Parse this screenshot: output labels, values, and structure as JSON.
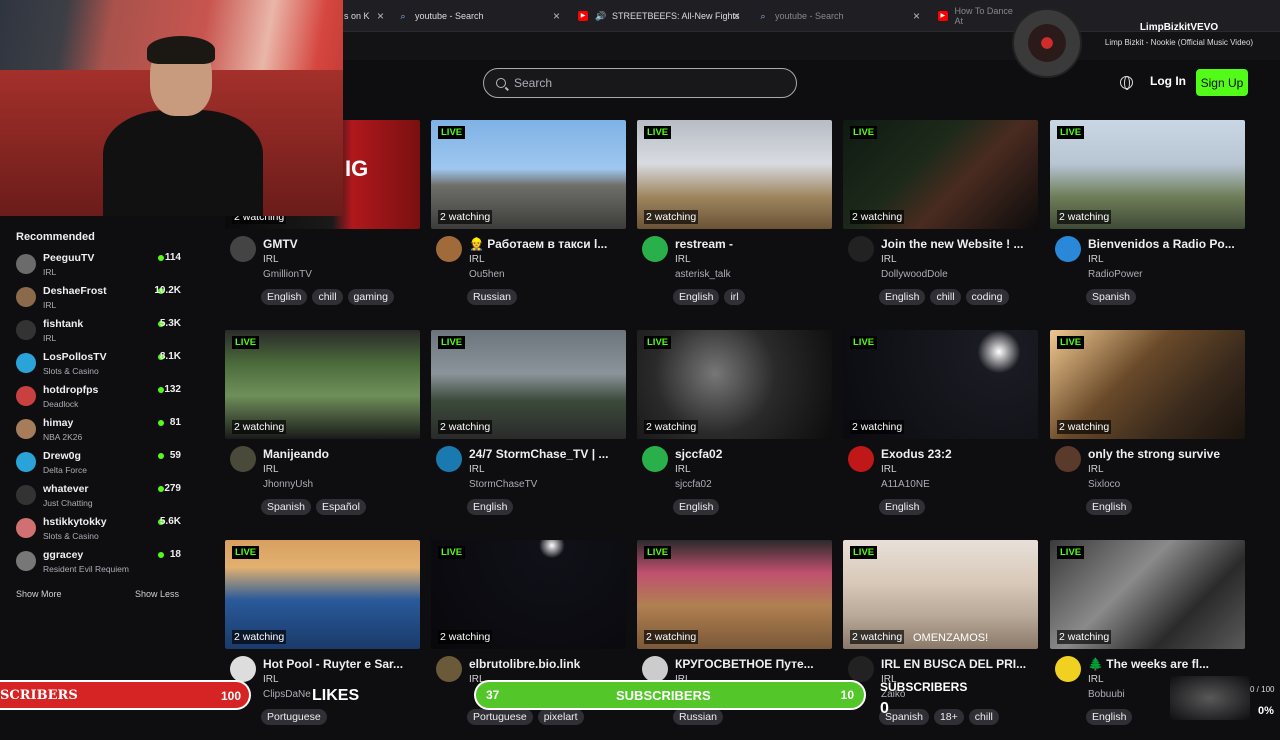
{
  "browser": {
    "tabs": [
      {
        "label": "s on K",
        "icon": "kick-icon"
      },
      {
        "label": "youtube - Search",
        "icon": "search-icon"
      },
      {
        "label": "STREETBEEFS: All-New Fights",
        "icon": "youtube-icon"
      },
      {
        "label": "youtube - Search",
        "icon": "search-icon"
      },
      {
        "label": "How To Dance At",
        "icon": "youtube-icon"
      }
    ]
  },
  "header": {
    "search_placeholder": "Search",
    "login_label": "Log In",
    "signup_label": "Sign Up"
  },
  "now_playing": {
    "artist": "LimpBizkitVEVO",
    "song": "Limp Bizkit - Nookie (Official Music Video)"
  },
  "sidebar": {
    "title": "Recommended",
    "channels": [
      {
        "name": "PeeguuTV",
        "category": "IRL",
        "viewers": "114"
      },
      {
        "name": "DeshaeFrost",
        "category": "IRL",
        "viewers": "10.2K"
      },
      {
        "name": "fishtank",
        "category": "IRL",
        "viewers": "5.3K"
      },
      {
        "name": "LosPollosTV",
        "category": "Slots & Casino",
        "viewers": "8.1K"
      },
      {
        "name": "hotdropfps",
        "category": "Deadlock",
        "viewers": "132"
      },
      {
        "name": "himay",
        "category": "NBA 2K26",
        "viewers": "81"
      },
      {
        "name": "Drew0g",
        "category": "Delta Force",
        "viewers": "59"
      },
      {
        "name": "whatever",
        "category": "Just Chatting",
        "viewers": "279"
      },
      {
        "name": "hstikkytokky",
        "category": "Slots & Casino",
        "viewers": "5.6K"
      },
      {
        "name": "ggracey",
        "category": "Resident Evil Requiem",
        "viewers": "18"
      }
    ],
    "show_more": "Show More",
    "show_less": "Show Less"
  },
  "streams": [
    {
      "title": "GMTV",
      "category": "IRL",
      "user": "GmillionTV",
      "watching": "2 watching",
      "live": "LIVE",
      "tags": [
        "English",
        "chill",
        "gaming"
      ]
    },
    {
      "title": "👷 Работаем в такси l...",
      "category": "IRL",
      "user": "Ou5hen",
      "watching": "2 watching",
      "live": "LIVE",
      "tags": [
        "Russian"
      ]
    },
    {
      "title": "restream -",
      "category": "IRL",
      "user": "asterisk_talk",
      "watching": "2 watching",
      "live": "LIVE",
      "tags": [
        "English",
        "irl"
      ]
    },
    {
      "title": "Join the new Website ! ...",
      "category": "IRL",
      "user": "DollywoodDole",
      "watching": "2 watching",
      "live": "LIVE",
      "tags": [
        "English",
        "chill",
        "coding"
      ]
    },
    {
      "title": "Bienvenidos a Radio Po...",
      "category": "IRL",
      "user": "RadioPower",
      "watching": "2 watching",
      "live": "LIVE",
      "tags": [
        "Spanish"
      ]
    },
    {
      "title": "Manijeando",
      "category": "IRL",
      "user": "JhonnyUsh",
      "watching": "2 watching",
      "live": "LIVE",
      "tags": [
        "Spanish",
        "Español"
      ]
    },
    {
      "title": "24/7 StormChase_TV | ...",
      "category": "IRL",
      "user": "StormChaseTV",
      "watching": "2 watching",
      "live": "LIVE",
      "tags": [
        "English"
      ]
    },
    {
      "title": "sjccfa02",
      "category": "IRL",
      "user": "sjccfa02",
      "watching": "2 watching",
      "live": "LIVE",
      "tags": [
        "English"
      ]
    },
    {
      "title": "Exodus 23:2",
      "category": "IRL",
      "user": "A11A10NE",
      "watching": "2 watching",
      "live": "LIVE",
      "tags": [
        "English"
      ]
    },
    {
      "title": "only the strong survive",
      "category": "IRL",
      "user": "Sixloco",
      "watching": "2 watching",
      "live": "LIVE",
      "tags": [
        "English"
      ]
    },
    {
      "title": "Hot Pool - Ruyter e Sar...",
      "category": "IRL",
      "user": "ClipsDaNe",
      "watching": "2 watching",
      "live": "LIVE",
      "tags": [
        "Portuguese"
      ]
    },
    {
      "title": "elbrutolibre.bio.link",
      "category": "IRL",
      "user": "",
      "watching": "2 watching",
      "live": "LIVE",
      "tags": [
        "Portuguese",
        "pixelart"
      ]
    },
    {
      "title": "КРУГОСВЕТНОЕ Путе...",
      "category": "IRL",
      "user": "",
      "watching": "2 watching",
      "live": "LIVE",
      "tags": [
        "Russian"
      ]
    },
    {
      "title": "IRL EN BUSCA DEL PRI...",
      "category": "IRL",
      "user": "Zaiko",
      "watching": "2 watching",
      "live": "LIVE",
      "tags": [
        "Spanish",
        "18+",
        "chill"
      ]
    },
    {
      "title": "🌲 The weeks are fl...",
      "category": "IRL",
      "user": "Bobuubi",
      "watching": "2 watching",
      "live": "LIVE",
      "tags": [
        "English"
      ]
    }
  ],
  "overlays": {
    "left_label": "SCRIBERS",
    "left_count": "100",
    "likes_label": "LIKES",
    "mid_start": "37",
    "mid_label": "SUBSCRIBERS",
    "mid_end": "10",
    "right_label": "SUBSCRIBERS",
    "right_count": "0",
    "right_goal": "0 / 100",
    "right_pct": "0%",
    "thumb_overlay_text": "OMENZAMOS!",
    "thumb_overlay_text2": "IG"
  },
  "colors": {
    "accent": "#53fc18",
    "background": "#0e0e10",
    "tag_bg": "#2f2f35"
  }
}
